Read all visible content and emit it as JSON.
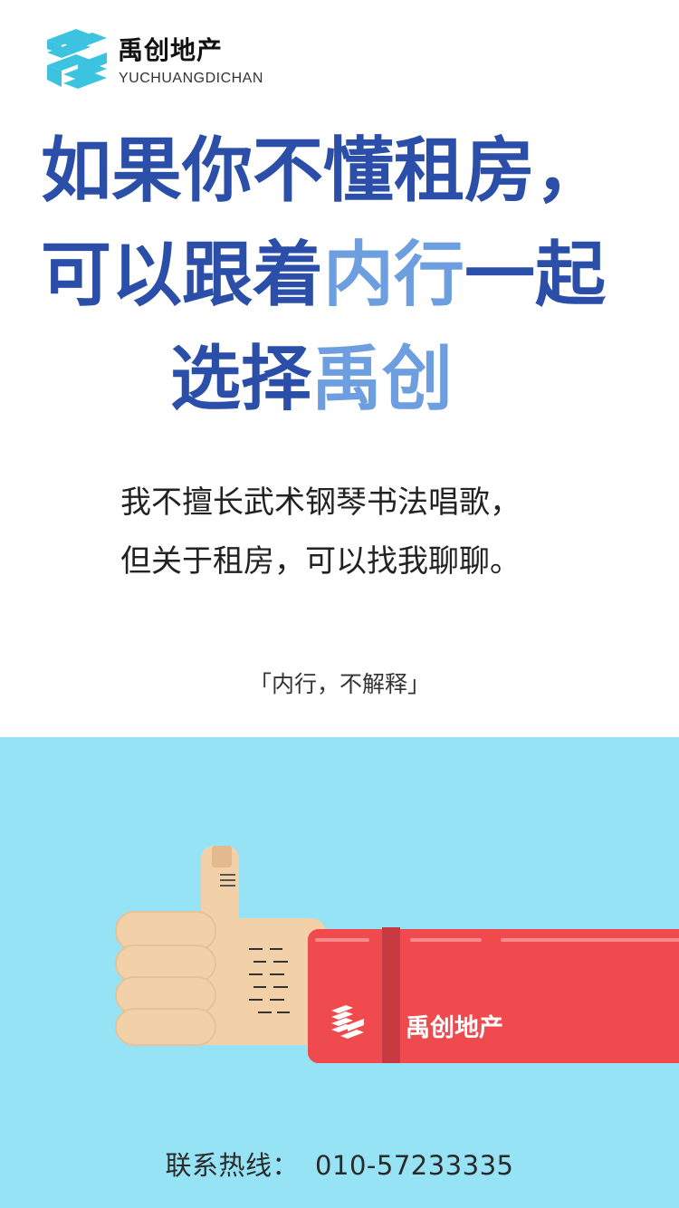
{
  "header": {
    "brand_cn": "禹创地产",
    "brand_en": "YUCHUANGDICHAN",
    "logo_icon": "stacked-building-logo-icon"
  },
  "headline": {
    "line1": "如果你不懂租房，",
    "line2_a": "可以跟着",
    "line2_b": "内行",
    "line2_c": "一起",
    "line3_a": "选择",
    "line3_b": "禹创"
  },
  "subtitle": {
    "line1": "我不擅长武术钢琴书法唱歌，",
    "line2": "但关于租房，可以找我聊聊。"
  },
  "motto": "「内行，不解释」",
  "illustration": {
    "sleeve_label": "禹创地产",
    "icon": "thumbs-up-icon"
  },
  "contact": {
    "label": "联系热线：",
    "phone": "010-57233335"
  },
  "colors": {
    "headline_blue": "#2b4ea8",
    "highlight_blue": "#6d9fe0",
    "panel_cyan": "#95e3f5",
    "sleeve_red": "#ef4b4f",
    "skin": "#f2d1a8"
  }
}
